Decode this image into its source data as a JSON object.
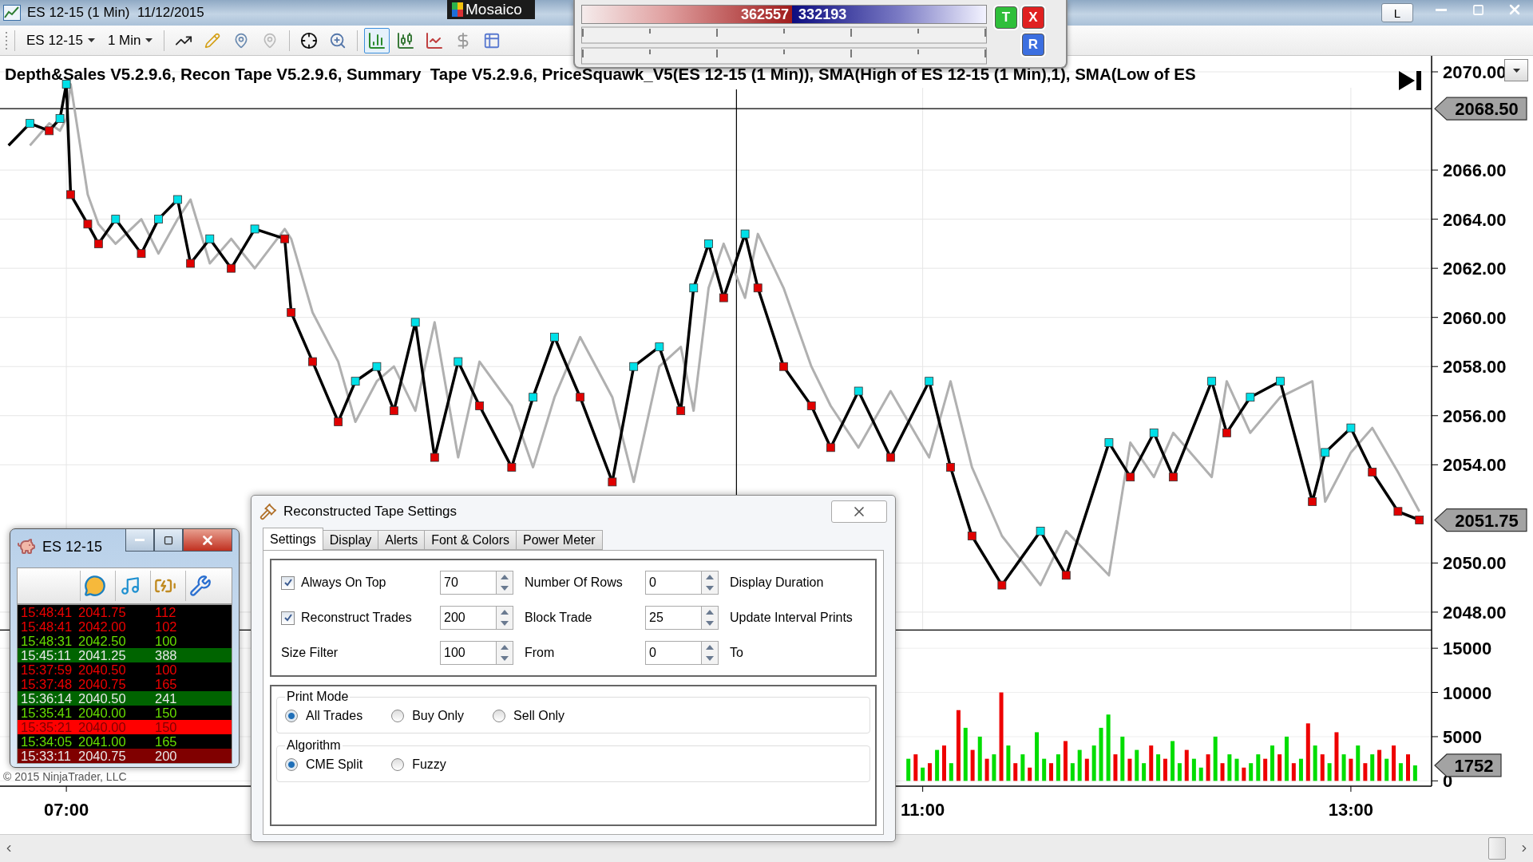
{
  "window": {
    "title": "ES 12-15 (1 Min)  11/12/2015",
    "app_label": "Mosaico",
    "button": "L"
  },
  "toolbar": {
    "instrument": "ES 12-15",
    "interval": "1 Min",
    "chart_styles": [
      {
        "kind": "bars",
        "selected": true
      },
      {
        "kind": "candles",
        "selected": false
      },
      {
        "kind": "line",
        "selected": false
      },
      {
        "kind": "dollar",
        "selected": false
      },
      {
        "kind": "table",
        "selected": false
      }
    ]
  },
  "power_meter": {
    "sell": "362557",
    "buy": "332193",
    "level": 0.52,
    "buttons": [
      [
        {
          "label": "T",
          "color": "#2fbf3a"
        },
        {
          "label": "X",
          "color": "#e02020"
        }
      ],
      [
        {
          "label": "R",
          "color": "#3c6fe0"
        }
      ]
    ]
  },
  "chart": {
    "title": "Depth&Sales V5.2.9.6, Recon Tape V5.2.9.6, Summary  Tape V5.2.9.6, PriceSquawk_V5(ES 12-15 (1 Min)), SMA(High of ES 12-15 (1 Min),1), SMA(Low of ES",
    "copyright": "© 2015 NinjaTrader, LLC"
  },
  "price_panel": {
    "chart_data": {
      "type": "line",
      "xlim": [
        6.69,
        13.377
      ],
      "ylim": [
        2047.25,
        2070.65
      ],
      "x": [
        6.73,
        6.83,
        6.92,
        6.97,
        7.0,
        7.02,
        7.1,
        7.15,
        7.23,
        7.35,
        7.43,
        7.52,
        7.58,
        7.67,
        7.77,
        7.88,
        8.02,
        8.05,
        8.15,
        8.27,
        8.35,
        8.45,
        8.53,
        8.63,
        8.72,
        8.83,
        8.93,
        9.08,
        9.18,
        9.28,
        9.4,
        9.55,
        9.65,
        9.77,
        9.87,
        9.93,
        10.0,
        10.07,
        10.17,
        10.23,
        10.35,
        10.48,
        10.57,
        10.7,
        10.85,
        11.03,
        11.13,
        11.23,
        11.37,
        11.55,
        11.67,
        11.87,
        11.97,
        12.08,
        12.17,
        12.35,
        12.42,
        12.53,
        12.67,
        12.82,
        12.88,
        13.0,
        13.1,
        13.22,
        13.32
      ],
      "grid": true,
      "series": [
        {
          "color": "#000000",
          "marker": "square",
          "values": [
            2067.0,
            2067.9,
            2067.6,
            2068.1,
            2069.5,
            2065.0,
            2063.8,
            2063.0,
            2064.0,
            2062.6,
            2064.0,
            2064.8,
            2062.2,
            2063.2,
            2062.0,
            2063.6,
            2063.2,
            2060.2,
            2058.2,
            2055.75,
            2057.4,
            2058.0,
            2056.2,
            2059.8,
            2054.3,
            2058.2,
            2056.4,
            2053.9,
            2056.75,
            2059.2,
            2056.75,
            2053.3,
            2058.0,
            2058.8,
            2056.2,
            2061.2,
            2063.0,
            2060.8,
            2063.4,
            2061.2,
            2058.0,
            2056.4,
            2054.7,
            2057.0,
            2054.3,
            2057.4,
            2053.9,
            2051.1,
            2049.1,
            2051.3,
            2049.5,
            2054.9,
            2053.5,
            2055.3,
            2053.5,
            2057.4,
            2055.3,
            2056.75,
            2057.4,
            2052.5,
            2054.5,
            2055.5,
            2053.7,
            2052.1,
            2051.75
          ]
        },
        {
          "color": "#b0b0b0",
          "values": [
            null,
            2067.0,
            2067.9,
            2067.6,
            2068.1,
            2069.5,
            2065.0,
            2063.8,
            2063.0,
            2064.0,
            2062.6,
            2064.0,
            2064.8,
            2062.2,
            2063.2,
            2062.0,
            2063.6,
            2063.2,
            2060.2,
            2058.2,
            2055.75,
            2057.4,
            2058.0,
            2056.2,
            2059.8,
            2054.3,
            2058.2,
            2056.4,
            2053.9,
            2056.75,
            2059.2,
            2056.75,
            2053.3,
            2058.0,
            2058.8,
            2056.2,
            2061.2,
            2063.0,
            2060.8,
            2063.4,
            2061.2,
            2058.0,
            2056.4,
            2054.7,
            2057.0,
            2054.3,
            2057.4,
            2053.9,
            2051.1,
            2049.1,
            2051.3,
            2049.5,
            2054.9,
            2053.5,
            2055.3,
            2053.5,
            2057.4,
            2055.3,
            2056.75,
            2057.4,
            2052.5,
            2054.5,
            2055.5,
            2053.7,
            2052.1
          ]
        }
      ],
      "yticks": [
        {
          "value": 2048,
          "label": "2048.00"
        },
        {
          "value": 2050,
          "label": "2050.00"
        },
        {
          "value": 2054,
          "label": "2054.00"
        },
        {
          "value": 2056,
          "label": "2056.00"
        },
        {
          "value": 2058,
          "label": "2058.00"
        },
        {
          "value": 2060,
          "label": "2060.00"
        },
        {
          "value": 2062,
          "label": "2062.00"
        },
        {
          "value": 2064,
          "label": "2064.00"
        },
        {
          "value": 2066,
          "label": "2066.00"
        },
        {
          "value": 2070,
          "label": "2070.00"
        }
      ],
      "ref_lines": [
        {
          "axis": "x",
          "value": 10.13
        },
        {
          "axis": "y",
          "value": 2068.5,
          "label": "2068.50"
        }
      ],
      "annotations": [
        "2051.75"
      ]
    }
  },
  "volume_panel": {
    "chart_data": {
      "type": "bar",
      "xlim": [
        6.69,
        13.377
      ],
      "ylim": [
        -600,
        17000
      ],
      "grid": true,
      "x": [
        10.933,
        10.967,
        11.0,
        11.033,
        11.067,
        11.1,
        11.133,
        11.167,
        11.2,
        11.233,
        11.267,
        11.3,
        11.333,
        11.367,
        11.4,
        11.433,
        11.467,
        11.5,
        11.533,
        11.567,
        11.6,
        11.633,
        11.667,
        11.7,
        11.733,
        11.767,
        11.8,
        11.833,
        11.867,
        11.9,
        11.933,
        11.967,
        12.0,
        12.033,
        12.067,
        12.1,
        12.133,
        12.167,
        12.2,
        12.233,
        12.267,
        12.3,
        12.333,
        12.367,
        12.4,
        12.433,
        12.467,
        12.5,
        12.533,
        12.567,
        12.6,
        12.633,
        12.667,
        12.7,
        12.733,
        12.767,
        12.8,
        12.833,
        12.867,
        12.9,
        12.933,
        12.967,
        13.0,
        13.033,
        13.067,
        13.1,
        13.133,
        13.167,
        13.2,
        13.233,
        13.267,
        13.3
      ],
      "series": [
        {
          "color": "#00dd00",
          "values": [
            2500,
            null,
            1500,
            null,
            3500,
            null,
            2000,
            null,
            6000,
            null,
            5000,
            null,
            3000,
            null,
            4000,
            null,
            3000,
            null,
            5500,
            2500,
            null,
            3000,
            null,
            2000,
            3500,
            null,
            4000,
            6000,
            7500,
            null,
            5000,
            null,
            3500,
            2000,
            null,
            3000,
            null,
            4500,
            2000,
            null,
            2500,
            1500,
            null,
            5000,
            null,
            3000,
            2500,
            null,
            2000,
            3000,
            null,
            4000,
            null,
            5000,
            null,
            2500,
            null,
            4000,
            null,
            2000,
            null,
            3000,
            null,
            4000,
            null,
            3000,
            null,
            2500,
            null,
            2000,
            null,
            1752
          ]
        },
        {
          "color": "#ee0000",
          "values": [
            null,
            3000,
            null,
            2000,
            null,
            4000,
            null,
            8000,
            null,
            3500,
            null,
            2500,
            null,
            10000,
            null,
            2000,
            null,
            1500,
            null,
            null,
            2000,
            null,
            4500,
            null,
            null,
            2500,
            null,
            null,
            null,
            3000,
            null,
            2500,
            null,
            null,
            4000,
            null,
            2500,
            null,
            null,
            3500,
            null,
            null,
            3000,
            null,
            2000,
            null,
            null,
            1500,
            null,
            null,
            2500,
            null,
            3000,
            null,
            2000,
            null,
            6500,
            null,
            3000,
            null,
            5500,
            null,
            2500,
            null,
            2000,
            null,
            3500,
            null,
            4000,
            null,
            3000,
            null
          ]
        }
      ],
      "xticks": [
        {
          "value": 7,
          "label": "07:00"
        },
        {
          "value": 11,
          "label": "11:00"
        },
        {
          "value": 13,
          "label": "13:00"
        }
      ],
      "yticks": [
        {
          "value": 0,
          "label": "0"
        },
        {
          "value": 5000,
          "label": "5000"
        },
        {
          "value": 10000,
          "label": "10000"
        },
        {
          "value": 15000,
          "label": "15000"
        }
      ],
      "annotations": [
        "1752"
      ]
    }
  },
  "tape_window": {
    "title": "ES 12-15",
    "rows": [
      {
        "time": "15:48:41",
        "price": "2041.75",
        "size": "112",
        "kind": "sell"
      },
      {
        "time": "15:48:41",
        "price": "2042.00",
        "size": "102",
        "kind": "sell"
      },
      {
        "time": "15:48:31",
        "price": "2042.50",
        "size": "100",
        "kind": "buy"
      },
      {
        "time": "15:45:11",
        "price": "2041.25",
        "size": "388",
        "kind": "block_buy"
      },
      {
        "time": "15:37:59",
        "price": "2040.50",
        "size": "100",
        "kind": "sell"
      },
      {
        "time": "15:37:48",
        "price": "2040.75",
        "size": "165",
        "kind": "sell"
      },
      {
        "time": "15:36:14",
        "price": "2040.50",
        "size": "241",
        "kind": "block_buy"
      },
      {
        "time": "15:35:41",
        "price": "2040.00",
        "size": "150",
        "kind": "buy"
      },
      {
        "time": "15:35:21",
        "price": "2040.00",
        "size": "150",
        "kind": "alert_sell"
      },
      {
        "time": "15:34:05",
        "price": "2041.00",
        "size": "165",
        "kind": "buy"
      },
      {
        "time": "15:33:11",
        "price": "2040.75",
        "size": "200",
        "kind": "block_sell"
      }
    ]
  },
  "dialog": {
    "title": "Reconstructed Tape Settings",
    "tabs": [
      {
        "label": "Settings",
        "selected": true
      },
      {
        "label": "Display",
        "selected": false
      },
      {
        "label": "Alerts",
        "selected": false
      },
      {
        "label": "Font & Colors",
        "selected": false
      },
      {
        "label": "Power Meter",
        "selected": false
      }
    ],
    "settings": [
      {
        "items": [
          {
            "kind": "checkbox",
            "text": "Always On Top",
            "checked": true
          },
          {
            "kind": "spinner",
            "text": "70"
          },
          {
            "kind": "label",
            "text": "Number Of Rows"
          },
          {
            "kind": "spinner",
            "text": "0"
          },
          {
            "kind": "label",
            "text": "Display Duration"
          }
        ]
      },
      {
        "items": [
          {
            "kind": "checkbox",
            "text": "Reconstruct Trades",
            "checked": true
          },
          {
            "kind": "spinner",
            "text": "200"
          },
          {
            "kind": "label",
            "text": "Block Trade"
          },
          {
            "kind": "spinner",
            "text": "25"
          },
          {
            "kind": "label",
            "text": "Update Interval Prints"
          }
        ]
      },
      {
        "items": [
          {
            "kind": "label",
            "text": "Size Filter"
          },
          {
            "kind": "spinner",
            "text": "100"
          },
          {
            "kind": "label",
            "text": "From"
          },
          {
            "kind": "spinner",
            "text": "0"
          },
          {
            "kind": "label",
            "text": "To"
          }
        ]
      }
    ],
    "groups": [
      {
        "title": "Print Mode",
        "options": [
          {
            "label": "All Trades",
            "selected": true
          },
          {
            "label": "Buy Only",
            "selected": false
          },
          {
            "label": "Sell Only",
            "selected": false
          }
        ]
      },
      {
        "title": "Algorithm",
        "options": [
          {
            "label": "CME Split",
            "selected": true
          },
          {
            "label": "Fuzzy",
            "selected": false
          }
        ]
      }
    ]
  }
}
